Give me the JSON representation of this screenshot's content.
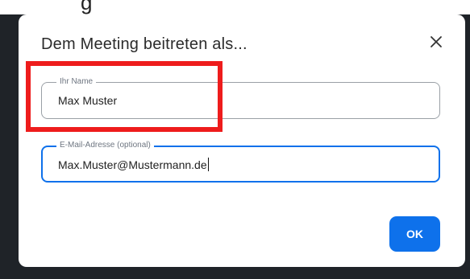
{
  "dialog": {
    "title": "Dem Meeting beitreten als...",
    "close_icon": "close-icon",
    "name_field": {
      "legend": "Ihr Name",
      "value": "Max Muster"
    },
    "email_field": {
      "legend": "E-Mail-Adresse (optional)",
      "value": "Max.Muster@Mustermann.de"
    },
    "ok_label": "OK"
  },
  "colors": {
    "accent": "#0e71eb",
    "highlight": "#ee1c1c",
    "backdrop": "#1f2328"
  }
}
